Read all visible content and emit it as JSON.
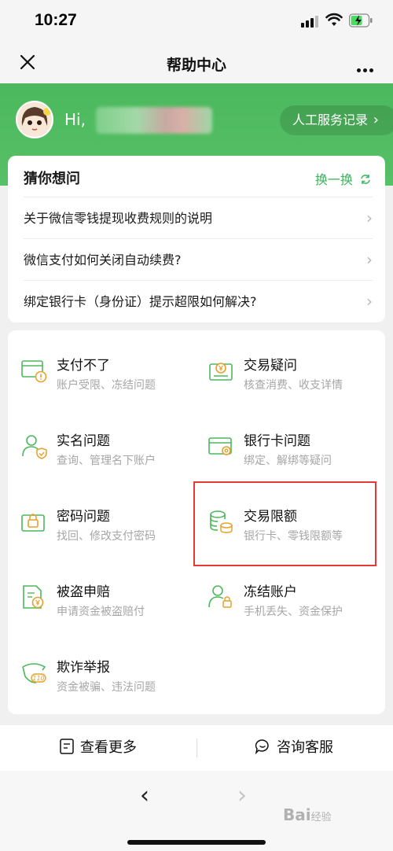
{
  "status_bar": {
    "time": "10:27"
  },
  "nav": {
    "title": "帮助中心"
  },
  "header": {
    "greeting": "Hi,",
    "service_record": "人工服务记录",
    "accent_color": "#4cb85d"
  },
  "faq": {
    "title": "猜你想问",
    "refresh_label": "换一换",
    "items": [
      {
        "label": "关于微信零钱提现收费规则的说明"
      },
      {
        "label": "微信支付如何关闭自动续费?"
      },
      {
        "label": "绑定银行卡（身份证）提示超限如何解决?"
      }
    ]
  },
  "categories": [
    {
      "title": "支付不了",
      "sub": "账户受限、冻结问题",
      "icon": "card-warning-icon"
    },
    {
      "title": "交易疑问",
      "sub": "核查消费、收支详情",
      "icon": "receipt-yen-icon"
    },
    {
      "title": "实名问题",
      "sub": "查询、管理名下账户",
      "icon": "user-check-icon"
    },
    {
      "title": "银行卡问题",
      "sub": "绑定、解绑等疑问",
      "icon": "bank-card-gear-icon"
    },
    {
      "title": "密码问题",
      "sub": "找回、修改支付密码",
      "icon": "lock-icon"
    },
    {
      "title": "交易限额",
      "sub": "银行卡、零钱限额等",
      "icon": "coins-stack-icon"
    },
    {
      "title": "被盗申赔",
      "sub": "申请资金被盗赔付",
      "icon": "document-yen-icon"
    },
    {
      "title": "冻结账户",
      "sub": "手机丢失、资金保护",
      "icon": "user-lock-icon"
    },
    {
      "title": "欺诈举报",
      "sub": "资金被骗、违法问题",
      "icon": "shield-110-icon"
    }
  ],
  "bottom": {
    "more_label": "查看更多",
    "service_label": "咨询客服"
  },
  "browser": {
    "back": "‹",
    "forward": "›"
  },
  "watermark": {
    "text": "Bai",
    "suffix": "经验"
  }
}
